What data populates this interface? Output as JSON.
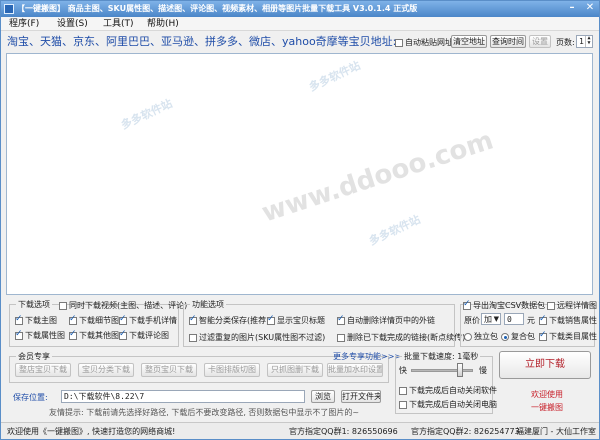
{
  "window": {
    "title": "【一键搬图】 商品主图、SKU属性图、描述图、评论图、视频素材、相册等图片批量下载工具 V3.0.1.4 正式版",
    "minimize": "–",
    "close": "✕"
  },
  "menu": [
    {
      "label": "程序(F)"
    },
    {
      "label": "设置(S)"
    },
    {
      "label": "工具(T)"
    },
    {
      "label": "帮助(H)"
    }
  ],
  "url_row": {
    "label": "淘宝、天猫、京东、阿里巴巴、亚马逊、拼多多、微店、yahoo奇摩等宝贝地址:",
    "auto_recognize": "自动粘贴网址",
    "clear_button": "清空地址",
    "query_button": "查询时间",
    "settings_button": "设置",
    "pages_label": "页数:",
    "pages_value": "1"
  },
  "watermarks": {
    "big_1": "www.ddooo.com",
    "small_1": "多多软件站",
    "small_2": "多多软件站",
    "small_3": "多多软件站"
  },
  "download_options": {
    "title": "下载选项",
    "sync_video": "同时下载视频(主图、描述、评论)",
    "items": [
      {
        "label": "下载主图",
        "checked": true
      },
      {
        "label": "下载细节图",
        "checked": true
      },
      {
        "label": "下载手机详情",
        "checked": true
      },
      {
        "label": "下载属性图",
        "checked": true
      },
      {
        "label": "下载其他图",
        "checked": true
      },
      {
        "label": "下载评论图",
        "checked": true
      }
    ]
  },
  "function_options": {
    "title": "功能选项",
    "items": [
      {
        "label": "智能分类保存(推荐)",
        "checked": true
      },
      {
        "label": "显示宝贝标题",
        "checked": true
      },
      {
        "label": "自动删除详情页中的外链",
        "checked": true
      },
      {
        "label": "过滤重复的图片(SKU属性图不过滤)",
        "checked": false
      },
      {
        "label": "删除已下载完成的链接(断点续传)",
        "checked": false
      }
    ]
  },
  "right_options": {
    "export_csv": "导出淘宝CSV数据包",
    "export_checked": true,
    "process_details": "远程详情图",
    "process_checked": false,
    "price_label": "原价",
    "price_op": "加",
    "price_value": "0",
    "price_unit": "元",
    "download_sales": "下载销售属性",
    "download_sales_checked": true,
    "radio_single": "独立包",
    "radio_merge": "复合包",
    "download_category": "下载类目属性",
    "download_category_checked": true
  },
  "vip": {
    "title": "会员专享",
    "more": "更多专享功能>>>",
    "buttons": [
      "整店宝贝下载",
      "宝贝分类下载",
      "整页宝贝下载",
      "卡图排版切图",
      "只抓图删下载",
      "批量加水印设置"
    ]
  },
  "speed": {
    "title": "批量下载速度: 1毫秒",
    "fast": "快",
    "slow": "慢",
    "level": 0.85,
    "after_done_close_software": "下载完成后自动关闭软件",
    "after_done_shutdown": "下载完成后自动关闭电脑"
  },
  "start_button": "立即下载",
  "welcome": {
    "line1": "欢迎使用",
    "line2": "一键搬图"
  },
  "save": {
    "label": "保存位置:",
    "path": "D:\\下载软件\\8.22\\7",
    "browse_button": "浏览",
    "open_folder_button": "打开文件夹",
    "tip": "友情提示: 下载前请先选择好路径, 下载后不要改变路径, 否则数据包中显示不了图片的~"
  },
  "status": {
    "welcome": "欢迎使用《一键搬图》, 快速打造您的网络商城!",
    "qq1": "官方指定QQ群1: 826550696",
    "qq2": "官方指定QQ群2: 826254773",
    "vendor": "福建厦门 - 大仙工作室"
  }
}
